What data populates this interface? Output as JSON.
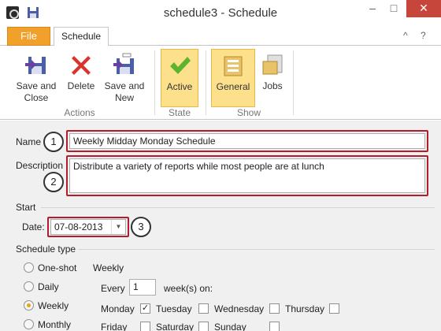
{
  "window": {
    "title": "schedule3 - Schedule",
    "minimize": "–",
    "maximize": "□",
    "close": "✕"
  },
  "tabs": {
    "file": "File",
    "schedule": "Schedule"
  },
  "ribbon_util": {
    "help": "?",
    "collapse": "^"
  },
  "ribbon": {
    "save_close": "Save and\nClose",
    "delete": "Delete",
    "save_new": "Save and\nNew",
    "active": "Active",
    "general": "General",
    "jobs": "Jobs",
    "groups": {
      "actions": "Actions",
      "state": "State",
      "show": "Show"
    }
  },
  "form": {
    "name_label": "Name",
    "name_value": "Weekly Midday Monday Schedule",
    "description_label": "Description",
    "description_value": "Distribute a variety of reports while most people are at lunch",
    "start_label": "Start",
    "date_label": "Date:",
    "date_value": "07-08-2013",
    "schedule_type_label": "Schedule type",
    "types": [
      "One-shot",
      "Daily",
      "Weekly",
      "Monthly"
    ],
    "selected_type": "Weekly",
    "weekly_title": "Weekly",
    "every_label": "Every",
    "every_value": "1",
    "weeks_on": "week(s) on:",
    "days": [
      "Monday",
      "Tuesday",
      "Wednesday",
      "Thursday",
      "Friday",
      "Saturday",
      "Sunday"
    ],
    "checked_days": [
      "Monday"
    ]
  },
  "callouts": [
    "1",
    "2",
    "3"
  ],
  "colors": {
    "accent_red": "#b11e2a",
    "active_yellow": "#fde08c",
    "file_orange": "#f1a02a"
  }
}
